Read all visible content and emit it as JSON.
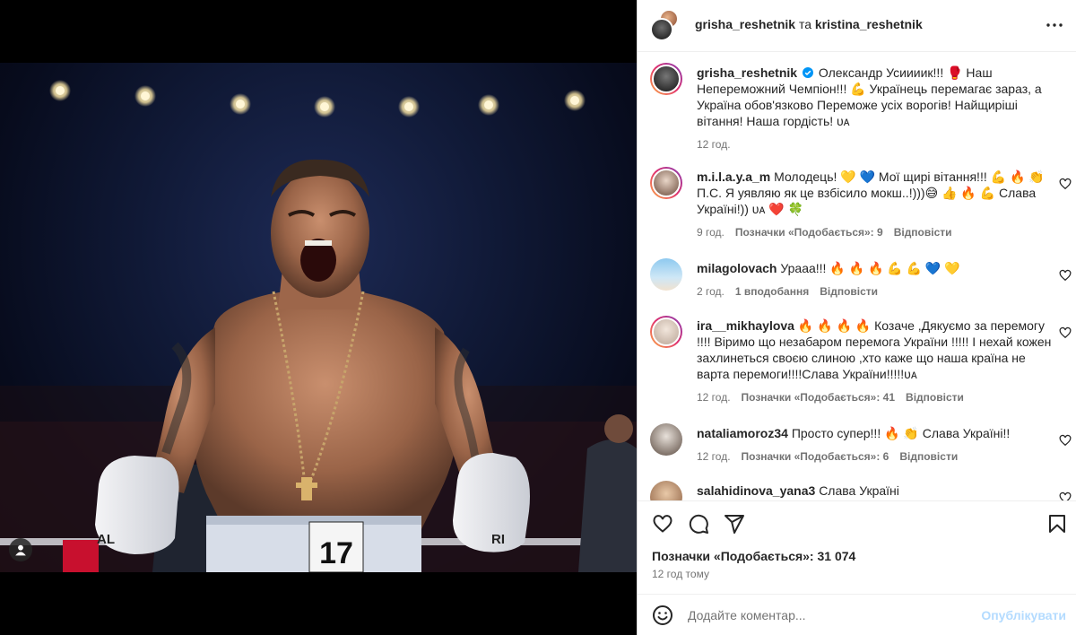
{
  "header": {
    "user1": "grisha_reshetnik",
    "conjunction": "та",
    "user2": "kristina_reshetnik"
  },
  "caption": {
    "username": "grisha_reshetnik",
    "text": "Олександр Усиииик!!! 🥊 Наш Непереможний Чемпіон!!! 💪 Українець перемагає зараз, а Україна обов'язково Переможе усіх ворогів! Найщиріші вітання! Наша гордість! ᴜᴀ",
    "time": "12 год."
  },
  "comments": [
    {
      "username": "m.i.l.a.y.a_m",
      "text": "Молодець! 💛 💙 Мої щирі вітання!!! 💪 🔥 👏 П.С. Я уявляю як це взбісило мокш..!)))😅 👍 🔥 💪 Слава Україні!)) ᴜᴀ ❤️ 🍀",
      "time": "9 год.",
      "likes": "Позначки «Подобається»: 9",
      "reply": "Відповісти"
    },
    {
      "username": "milagolovach",
      "text": "Урааа!!! 🔥 🔥 🔥 💪 💪 💙 💛",
      "time": "2 год.",
      "likes": "1 вподобання",
      "reply": "Відповісти"
    },
    {
      "username": "ira__mikhaylova",
      "text": "🔥 🔥 🔥 🔥 Козаче ,Дякуємо за перемогу !!!! Віримо що незабаром перемога України !!!!! І нехай кожен захлинеться своєю слиною ,хто каже що наша країна не варта перемоги!!!!Слава України!!!!!ᴜᴀ",
      "time": "12 год.",
      "likes": "Позначки «Подобається»: 41",
      "reply": "Відповісти"
    },
    {
      "username": "nataliamoroz34",
      "text": "Просто супер!!! 🔥 👏 Слава Україні!!",
      "time": "12 год.",
      "likes": "Позначки «Подобається»: 6",
      "reply": "Відповісти"
    },
    {
      "username": "salahidinova_yana3",
      "text": "Слава Україні",
      "time": "",
      "likes": "",
      "reply": ""
    }
  ],
  "footer": {
    "likes": "Позначки «Подобається»: 31 074",
    "time": "12 год тому",
    "comment_placeholder": "Додайте коментар...",
    "post_label": "Опублікувати"
  },
  "photo": {
    "trunks_number": "17",
    "glove_left": "AL",
    "glove_right": "RI"
  },
  "colors": {
    "verified": "#0095f6",
    "post_disabled": "#b3dbff",
    "muted": "#737373"
  }
}
